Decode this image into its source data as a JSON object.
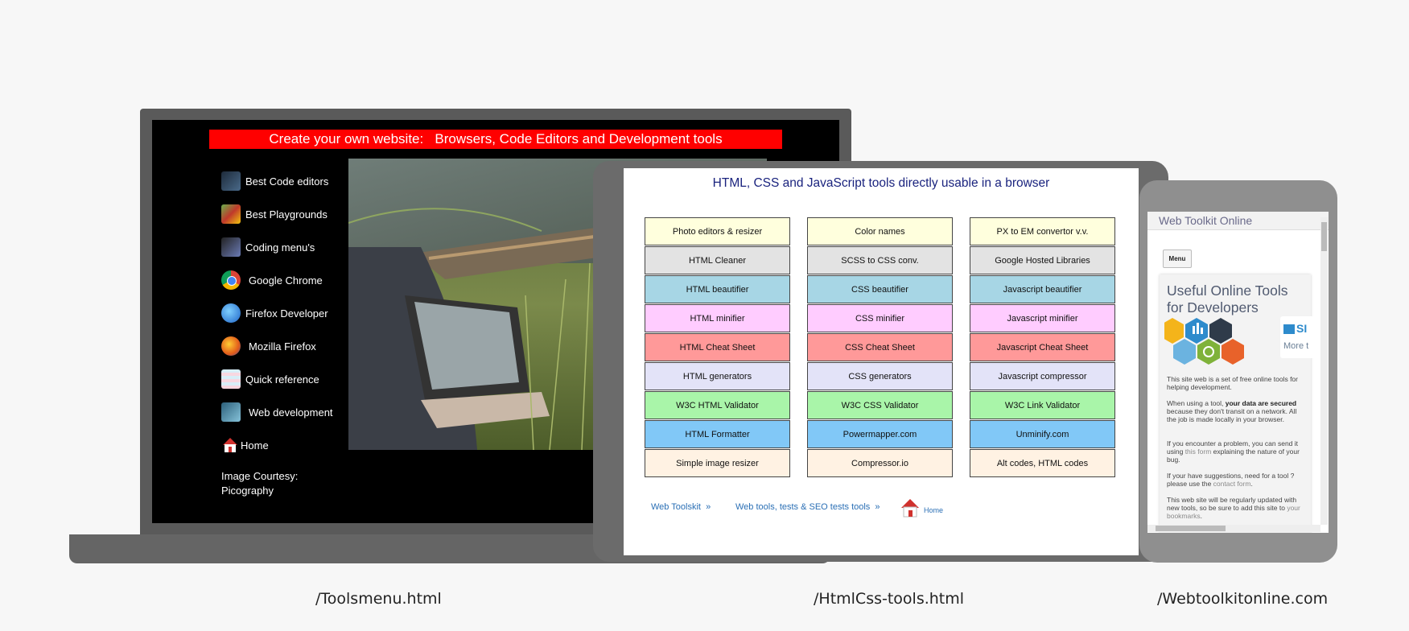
{
  "laptop": {
    "banner": "Create your own website:   Browsers, Code Editors and Development tools",
    "menu": [
      {
        "label": "Best Code editors",
        "icon": "code-editor-icon"
      },
      {
        "label": "Best Playgrounds",
        "icon": "playground-icon"
      },
      {
        "label": "Coding menu's",
        "icon": "coding-menu-icon"
      },
      {
        "label": "Google Chrome",
        "icon": "chrome-icon"
      },
      {
        "label": "Firefox Developer",
        "icon": "firefox-developer-icon"
      },
      {
        "label": "Mozilla Firefox",
        "icon": "firefox-icon"
      },
      {
        "label": "Quick reference",
        "icon": "quick-reference-icon"
      },
      {
        "label": "Web development",
        "icon": "web-development-icon"
      },
      {
        "label": "Home",
        "icon": "home-icon"
      }
    ],
    "courtesy_line1": "Image Courtesy:",
    "courtesy_line2": "Picography"
  },
  "tablet": {
    "title": "HTML, CSS and JavaScript tools directly usable in a browser",
    "rows": [
      {
        "color": "#ffffdd",
        "cells": [
          "Photo editors & resizer",
          "Color names",
          "PX to EM convertor v.v."
        ]
      },
      {
        "color": "#e3e3e3",
        "cells": [
          "HTML Cleaner",
          "SCSS to CSS conv.",
          "Google Hosted Libraries"
        ]
      },
      {
        "color": "#a7d6e5",
        "cells": [
          "HTML beautifier",
          "CSS beautifier",
          "Javascript beautifier"
        ]
      },
      {
        "color": "#ffccff",
        "cells": [
          "HTML minifier",
          "CSS minifier",
          "Javascript minifier"
        ]
      },
      {
        "color": "#ff9999",
        "cells": [
          "HTML Cheat Sheet",
          "CSS Cheat Sheet",
          "Javascript Cheat Sheet"
        ]
      },
      {
        "color": "#e3e3f8",
        "cells": [
          "HTML generators",
          "CSS generators",
          "Javascript compressor"
        ]
      },
      {
        "color": "#a9f5a9",
        "cells": [
          "W3C HTML Validator",
          "W3C CSS Validator",
          "W3C Link Validator"
        ]
      },
      {
        "color": "#81c8f7",
        "cells": [
          "HTML Formatter",
          "Powermapper.com",
          "Unminify.com"
        ]
      },
      {
        "color": "#fff2e3",
        "cells": [
          "Simple image resizer",
          "Compressor.io",
          "Alt codes, HTML codes"
        ]
      }
    ],
    "footer": {
      "link1": "Web Toolskit  »",
      "link2": "Web tools, tests & SEO tests tools  »",
      "home": "Home"
    }
  },
  "phone": {
    "header": "Web Toolkit Online",
    "menu_button": "Menu",
    "card_title": "Useful Online Tools for Developers",
    "badge_text": "SI",
    "badge_more": "More t",
    "p1": "This site web is a set of free online tools for helping development.",
    "p2_a": "When using a tool, ",
    "p2_b": "your data are secured",
    "p2_c": " because they don't transit on a network. All the job is made locally in your browser.",
    "p3_a": "If you encounter a problem, you can send it using ",
    "p3_link": "this form",
    "p3_c": " explaining the nature of your bug.",
    "p4_a": "If your have suggestions, need for a tool ? please use the ",
    "p4_link": "contact form",
    "p4_c": ".",
    "p5_a": "This web site will be regularly updated with new tools, so be sure to add this site to ",
    "p5_link": "your bookmarks",
    "p5_c": "."
  },
  "captions": [
    "/Toolsmenu.html",
    "/HtmlCss-tools.html",
    "/Webtoolkitonline.com"
  ]
}
